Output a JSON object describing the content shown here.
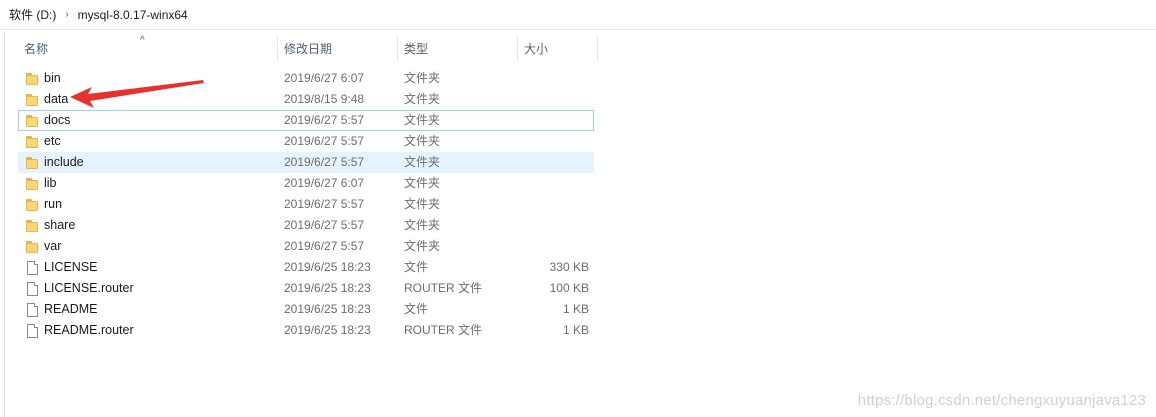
{
  "breadcrumb": {
    "drive": "软件 (D:)",
    "separator": "›",
    "folder": "mysql-8.0.17-winx64"
  },
  "header": {
    "name": "名称",
    "modified": "修改日期",
    "type": "类型",
    "size": "大小",
    "sort_indicator": "^"
  },
  "files": [
    {
      "name": "bin",
      "date": "2019/6/27 6:07",
      "type": "文件夹",
      "size": "",
      "kind": "folder"
    },
    {
      "name": "data",
      "date": "2019/8/15 9:48",
      "type": "文件夹",
      "size": "",
      "kind": "folder"
    },
    {
      "name": "docs",
      "date": "2019/6/27 5:57",
      "type": "文件夹",
      "size": "",
      "kind": "folder"
    },
    {
      "name": "etc",
      "date": "2019/6/27 5:57",
      "type": "文件夹",
      "size": "",
      "kind": "folder"
    },
    {
      "name": "include",
      "date": "2019/6/27 5:57",
      "type": "文件夹",
      "size": "",
      "kind": "folder"
    },
    {
      "name": "lib",
      "date": "2019/6/27 6:07",
      "type": "文件夹",
      "size": "",
      "kind": "folder"
    },
    {
      "name": "run",
      "date": "2019/6/27 5:57",
      "type": "文件夹",
      "size": "",
      "kind": "folder"
    },
    {
      "name": "share",
      "date": "2019/6/27 5:57",
      "type": "文件夹",
      "size": "",
      "kind": "folder"
    },
    {
      "name": "var",
      "date": "2019/6/27 5:57",
      "type": "文件夹",
      "size": "",
      "kind": "folder"
    },
    {
      "name": "LICENSE",
      "date": "2019/6/25 18:23",
      "type": "文件",
      "size": "330 KB",
      "kind": "file"
    },
    {
      "name": "LICENSE.router",
      "date": "2019/6/25 18:23",
      "type": "ROUTER 文件",
      "size": "100 KB",
      "kind": "file"
    },
    {
      "name": "README",
      "date": "2019/6/25 18:23",
      "type": "文件",
      "size": "1 KB",
      "kind": "file"
    },
    {
      "name": "README.router",
      "date": "2019/6/25 18:23",
      "type": "ROUTER 文件",
      "size": "1 KB",
      "kind": "file"
    }
  ],
  "annotation": {
    "arrow_color": "#e8302c",
    "points_to": "data"
  },
  "colors": {
    "selection_outline": "#99d1ff",
    "hover_row": "#e5f3ff",
    "header_text": "#4c607a",
    "folder": "#f8d775"
  },
  "watermark": "https://blog.csdn.net/chengxuyuanjava123"
}
